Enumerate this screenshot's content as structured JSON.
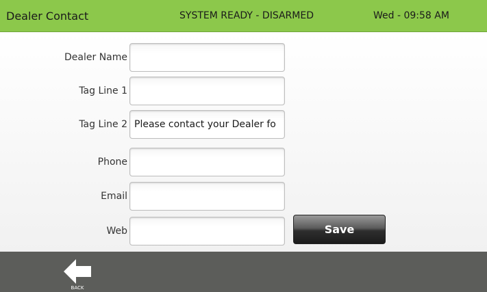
{
  "header": {
    "title": "Dealer Contact",
    "status": "SYSTEM READY - DISARMED",
    "clock": "Wed - 09:58 AM"
  },
  "form": {
    "fields": [
      {
        "label": "Dealer Name",
        "value": ""
      },
      {
        "label": "Tag Line 1",
        "value": ""
      },
      {
        "label": "Tag Line 2",
        "value": "Please contact your Dealer fo"
      },
      {
        "label": "Phone",
        "value": ""
      },
      {
        "label": "Email",
        "value": ""
      },
      {
        "label": "Web",
        "value": ""
      }
    ],
    "save_label": "Save"
  },
  "footer": {
    "back_label": "BACK",
    "back_icon": "left-arrow-icon"
  },
  "colors": {
    "header_bg": "#8cc84b",
    "footer_bg": "#5c5d5a",
    "button_dark": "#1c1c1c"
  }
}
